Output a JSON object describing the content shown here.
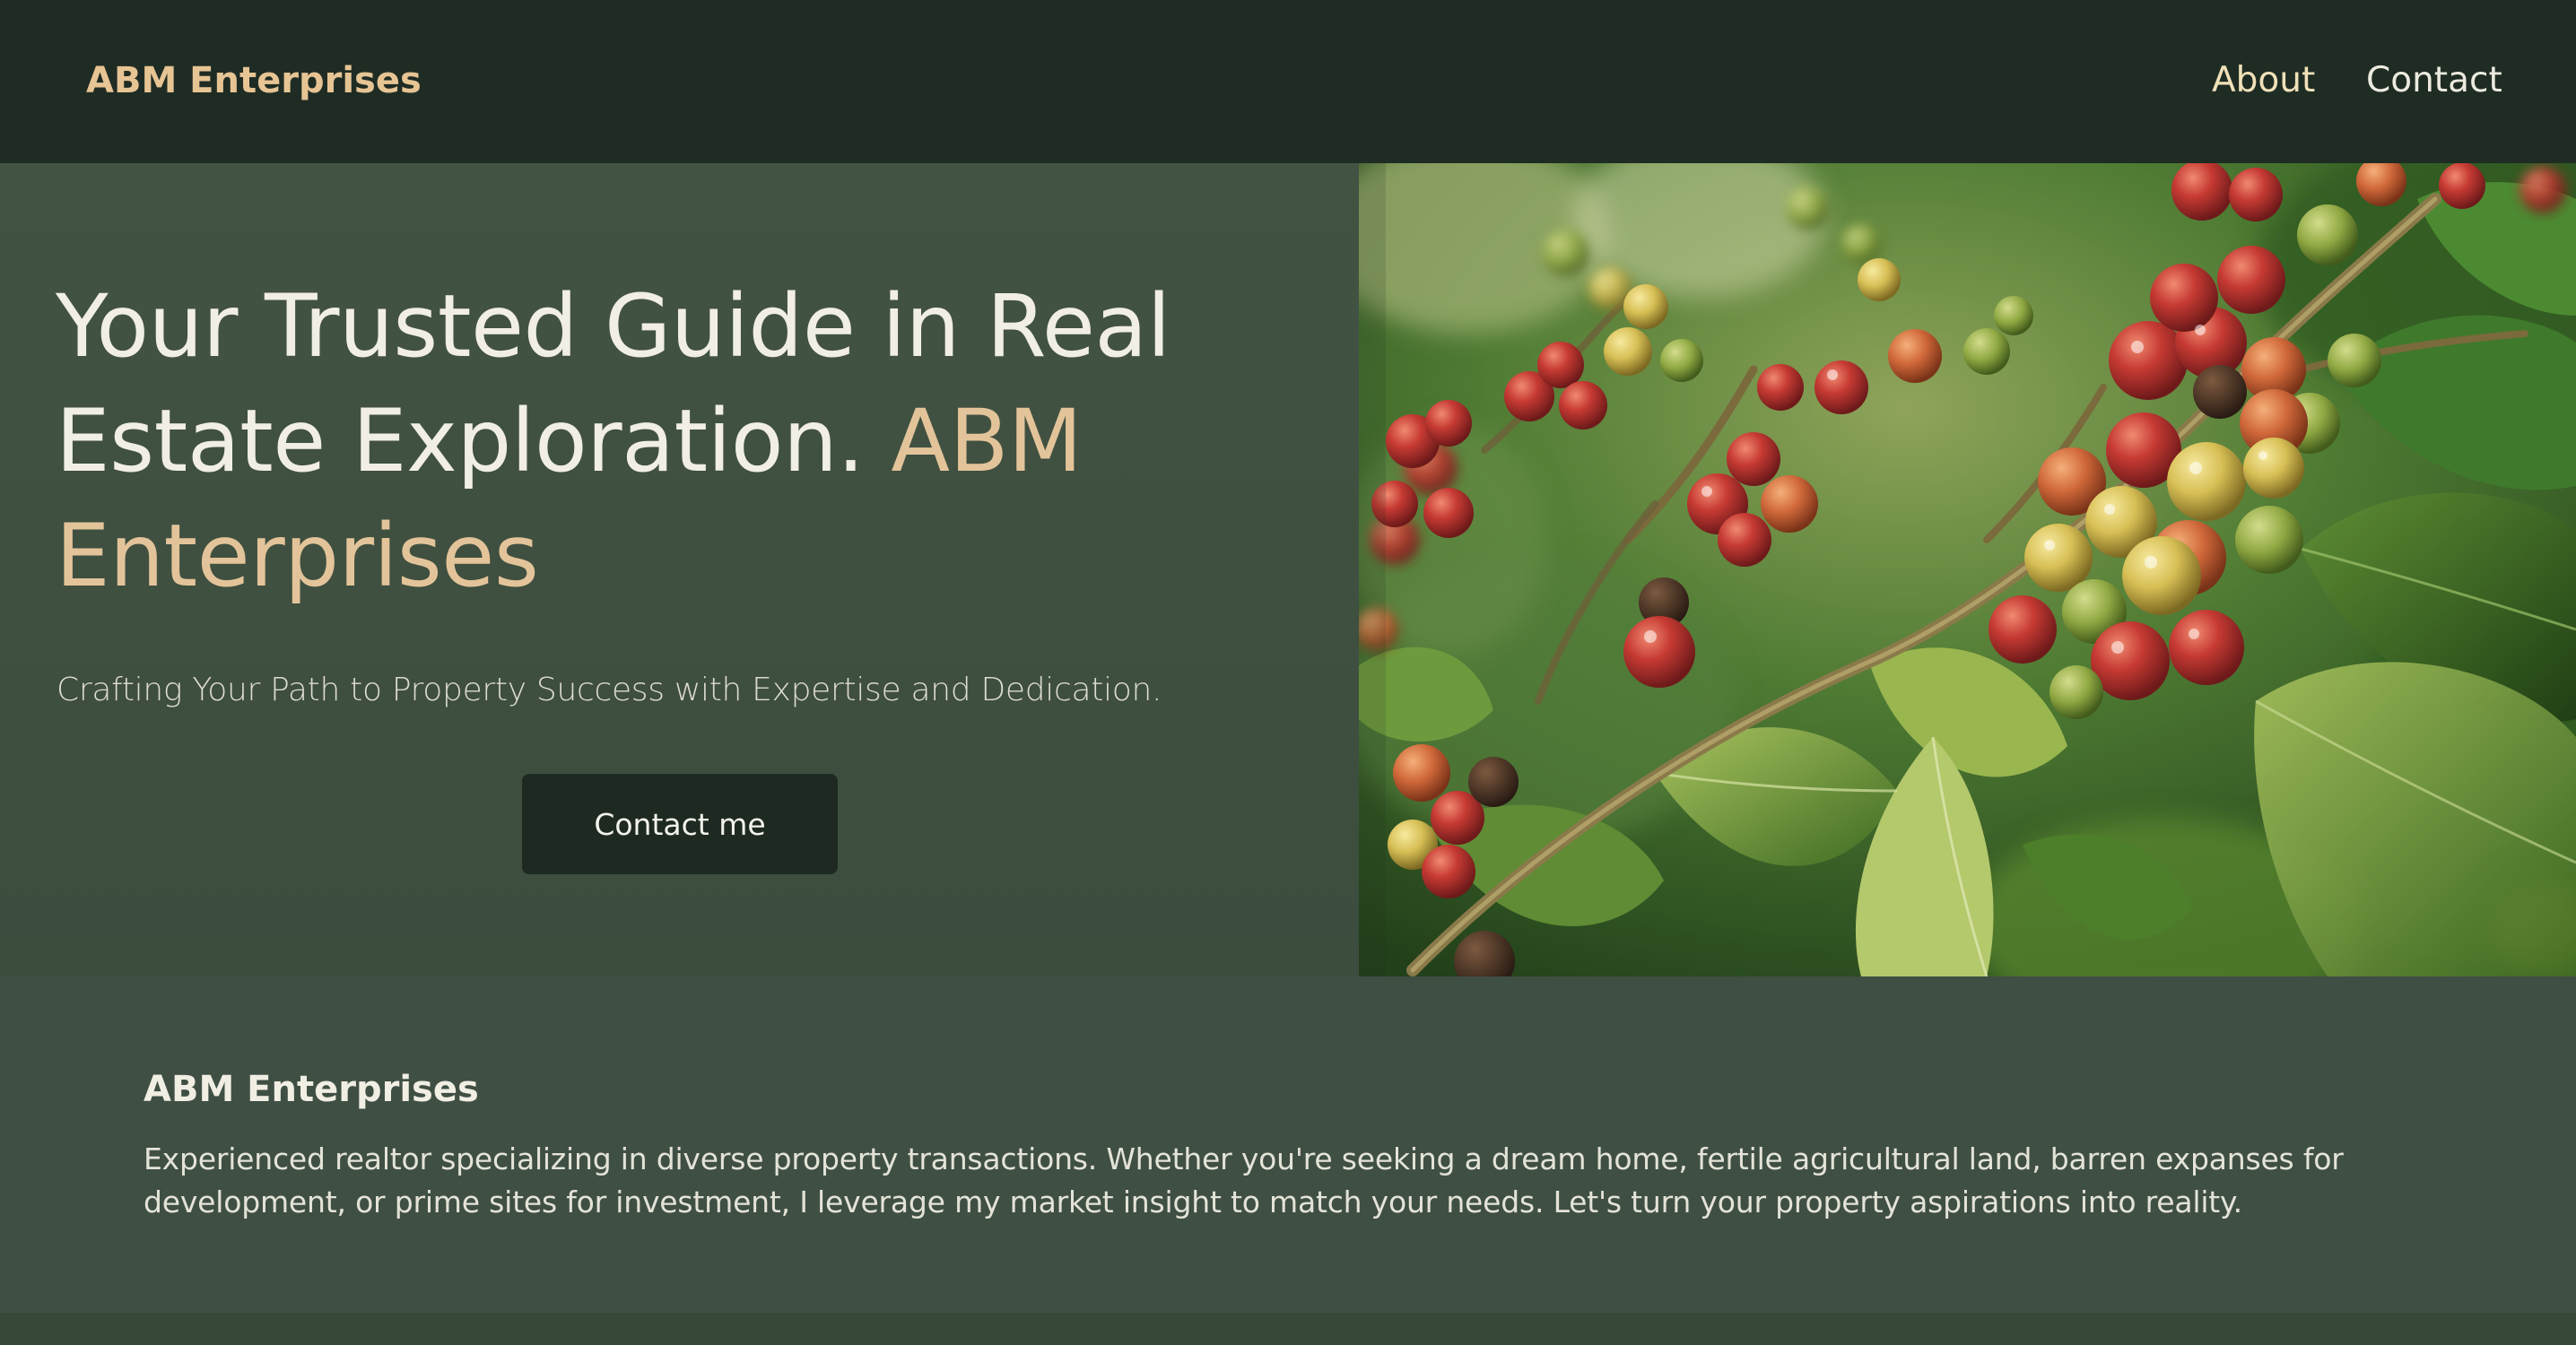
{
  "nav": {
    "brand": "ABM Enterprises",
    "links": [
      {
        "label": "About"
      },
      {
        "label": "Contact"
      }
    ]
  },
  "hero": {
    "title_main": "Your Trusted Guide in Real Estate Exploration.",
    "title_accent": "ABM Enterprises",
    "subtitle": "Crafting Your Path to Property Success with Expertise and Dedication.",
    "cta_label": "Contact me",
    "image_icon": "coffee-cherries-photo"
  },
  "about": {
    "title": "ABM Enterprises",
    "text": "Experienced realtor specializing in diverse property transactions. Whether you're seeking a dream home, fertile agricultural land, barren expanses for development, or prime sites for investment, I leverage my market insight to match your needs. Let's turn your property aspirations into reality."
  },
  "colors": {
    "nav_bg": "#1f2c24",
    "hero_bg": "#3c4c3d",
    "accent": "#e3c49a",
    "button_bg": "#1e2a21"
  }
}
